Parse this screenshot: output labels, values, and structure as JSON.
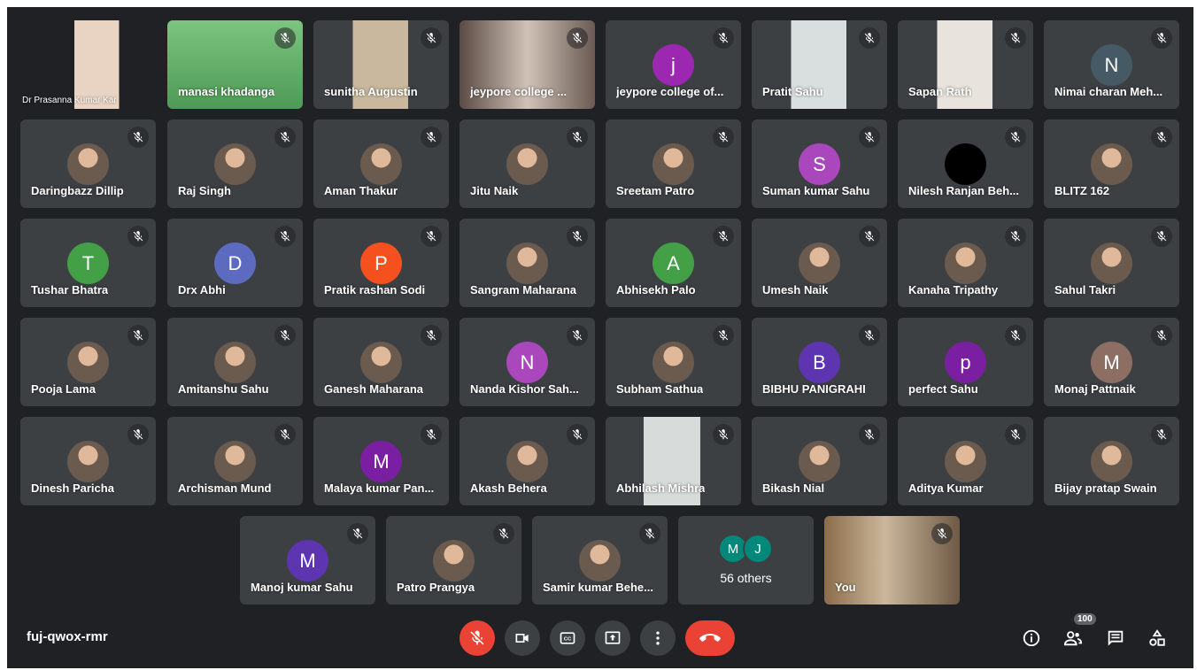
{
  "meeting": {
    "code": "fuj-qwox-rmr"
  },
  "participants": [
    {
      "name": "Dr Prasanna Kumar Kar",
      "type": "video",
      "muted": false
    },
    {
      "name": "manasi khadanga",
      "type": "video",
      "muted": true
    },
    {
      "name": "sunitha Augustin",
      "type": "video",
      "muted": true
    },
    {
      "name": "jeypore college ...",
      "type": "video",
      "muted": true
    },
    {
      "name": "jeypore college of...",
      "type": "initial",
      "initial": "j",
      "color": "#9c27b0",
      "muted": true
    },
    {
      "name": "Pratit Sahu",
      "type": "video",
      "muted": true
    },
    {
      "name": "Sapan Rath",
      "type": "video",
      "muted": true
    },
    {
      "name": "Nimai charan Meh...",
      "type": "initial",
      "initial": "N",
      "color": "#455a64",
      "muted": true
    },
    {
      "name": "Daringbazz Dillip",
      "type": "photo",
      "muted": true
    },
    {
      "name": "Raj Singh",
      "type": "photo",
      "muted": true
    },
    {
      "name": "Aman Thakur",
      "type": "photo",
      "muted": true
    },
    {
      "name": "Jitu Naik",
      "type": "photo",
      "muted": true
    },
    {
      "name": "Sreetam Patro",
      "type": "photo",
      "muted": true
    },
    {
      "name": "Suman kumar Sahu",
      "type": "initial",
      "initial": "S",
      "color": "#ab47bc",
      "muted": true
    },
    {
      "name": "Nilesh Ranjan Beh...",
      "type": "photo",
      "color": "#000000",
      "muted": true
    },
    {
      "name": "BLITZ 162",
      "type": "photo",
      "muted": true
    },
    {
      "name": "Tushar Bhatra",
      "type": "initial",
      "initial": "T",
      "color": "#43a047",
      "muted": true
    },
    {
      "name": "Drx Abhi",
      "type": "initial",
      "initial": "D",
      "color": "#5c6bc0",
      "muted": true
    },
    {
      "name": "Pratik rashan Sodi",
      "type": "initial",
      "initial": "P",
      "color": "#f4511e",
      "muted": true
    },
    {
      "name": "Sangram Maharana",
      "type": "photo",
      "muted": true
    },
    {
      "name": "Abhisekh Palo",
      "type": "initial",
      "initial": "A",
      "color": "#43a047",
      "muted": true
    },
    {
      "name": "Umesh Naik",
      "type": "photo",
      "muted": true
    },
    {
      "name": "Kanaha Tripathy",
      "type": "photo",
      "muted": true
    },
    {
      "name": "Sahul Takri",
      "type": "photo",
      "muted": true
    },
    {
      "name": "Pooja Lama",
      "type": "photo",
      "muted": true
    },
    {
      "name": "Amitanshu Sahu",
      "type": "photo",
      "muted": true
    },
    {
      "name": "Ganesh Maharana",
      "type": "photo",
      "muted": true
    },
    {
      "name": "Nanda Kishor Sah...",
      "type": "initial",
      "initial": "N",
      "color": "#ab47bc",
      "muted": true
    },
    {
      "name": "Subham Sathua",
      "type": "photo",
      "muted": true
    },
    {
      "name": "BIBHU PANIGRAHI",
      "type": "initial",
      "initial": "B",
      "color": "#5e35b1",
      "muted": true
    },
    {
      "name": "perfect Sahu",
      "type": "initial",
      "initial": "p",
      "color": "#7b1fa2",
      "muted": true
    },
    {
      "name": "Monaj Pattnaik",
      "type": "initial",
      "initial": "M",
      "color": "#8d6e63",
      "muted": true
    },
    {
      "name": "Dinesh Paricha",
      "type": "photo",
      "muted": true
    },
    {
      "name": "Archisman Mund",
      "type": "photo",
      "muted": true
    },
    {
      "name": "Malaya kumar Pan...",
      "type": "initial",
      "initial": "M",
      "color": "#7b1fa2",
      "muted": true
    },
    {
      "name": "Akash Behera",
      "type": "photo",
      "muted": true
    },
    {
      "name": "Abhilash Mishra",
      "type": "video",
      "muted": true
    },
    {
      "name": "Bikash Nial",
      "type": "photo",
      "muted": true
    },
    {
      "name": "Aditya Kumar",
      "type": "photo",
      "muted": true
    },
    {
      "name": "Bijay pratap Swain",
      "type": "photo",
      "muted": true
    },
    {
      "name": "Manoj kumar Sahu",
      "type": "initial",
      "initial": "M",
      "color": "#5e35b1",
      "muted": true
    },
    {
      "name": "Patro Prangya",
      "type": "photo",
      "muted": true
    },
    {
      "name": "Samir kumar Behe...",
      "type": "photo",
      "muted": true
    }
  ],
  "others": {
    "label": "56 others",
    "initials": [
      "M",
      "J"
    ]
  },
  "self": {
    "name": "You",
    "muted": true
  },
  "controls": {
    "mic": "mic-off-icon",
    "camera": "videocam-icon",
    "captions": "closed-captions-icon",
    "present": "present-screen-icon",
    "more": "more-vert-icon",
    "end": "call-end-icon"
  },
  "right": {
    "participant_count": "100"
  },
  "colors": {
    "background": "#202124",
    "tile": "#3c4043",
    "end_call": "#ea4335"
  }
}
